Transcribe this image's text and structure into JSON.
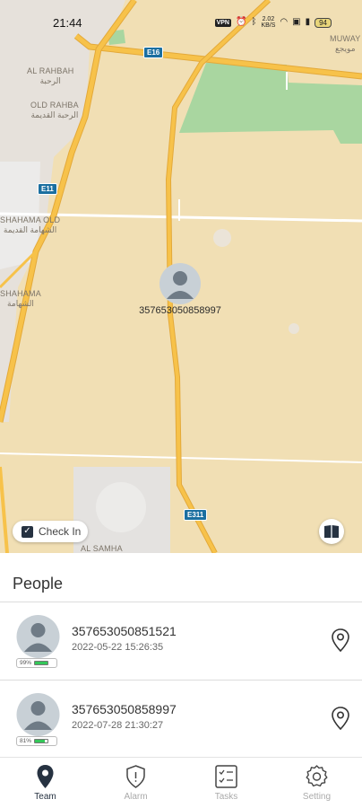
{
  "status_bar": {
    "time": "21:44",
    "vpn_label": "VPN",
    "speed": "2.02",
    "speed_unit": "KB/S",
    "battery": "94"
  },
  "map": {
    "places": [
      {
        "en": "AL RAHBAH",
        "ar": "الرحبة"
      },
      {
        "en": "OLD RAHBA",
        "ar": "الرحبة القديمة"
      },
      {
        "en": "SHAHAMA OLD",
        "ar": "الشهامة القديمة"
      },
      {
        "en": "SHAHAMA",
        "ar": "الشهامة"
      },
      {
        "en": "MUWAY",
        "ar": "مويجع"
      },
      {
        "en": "AL SAMHA",
        "ar": ""
      }
    ],
    "road_shields": [
      "E16",
      "E11",
      "E311"
    ],
    "marker_label": "357653050858997",
    "checkin_label": "Check In",
    "checkin_checked": true
  },
  "people": {
    "title": "People",
    "items": [
      {
        "id": "357653050851521",
        "time": "2022-05-22 15:26:35",
        "battery_pct": "99%",
        "battery_level": 0.99
      },
      {
        "id": "357653050858997",
        "time": "2022-07-28 21:30:27",
        "battery_pct": "81%",
        "battery_level": 0.81
      }
    ]
  },
  "tabs": [
    {
      "label": "Team",
      "icon": "location-pin-icon",
      "active": true
    },
    {
      "label": "Alarm",
      "icon": "shield-alert-icon",
      "active": false
    },
    {
      "label": "Tasks",
      "icon": "checklist-icon",
      "active": false
    },
    {
      "label": "Setting",
      "icon": "gear-icon",
      "active": false
    }
  ],
  "colors": {
    "map_background": "#f1dfb4",
    "road": "#f7c24a",
    "park": "#a9d6a0",
    "accent": "#263241"
  }
}
